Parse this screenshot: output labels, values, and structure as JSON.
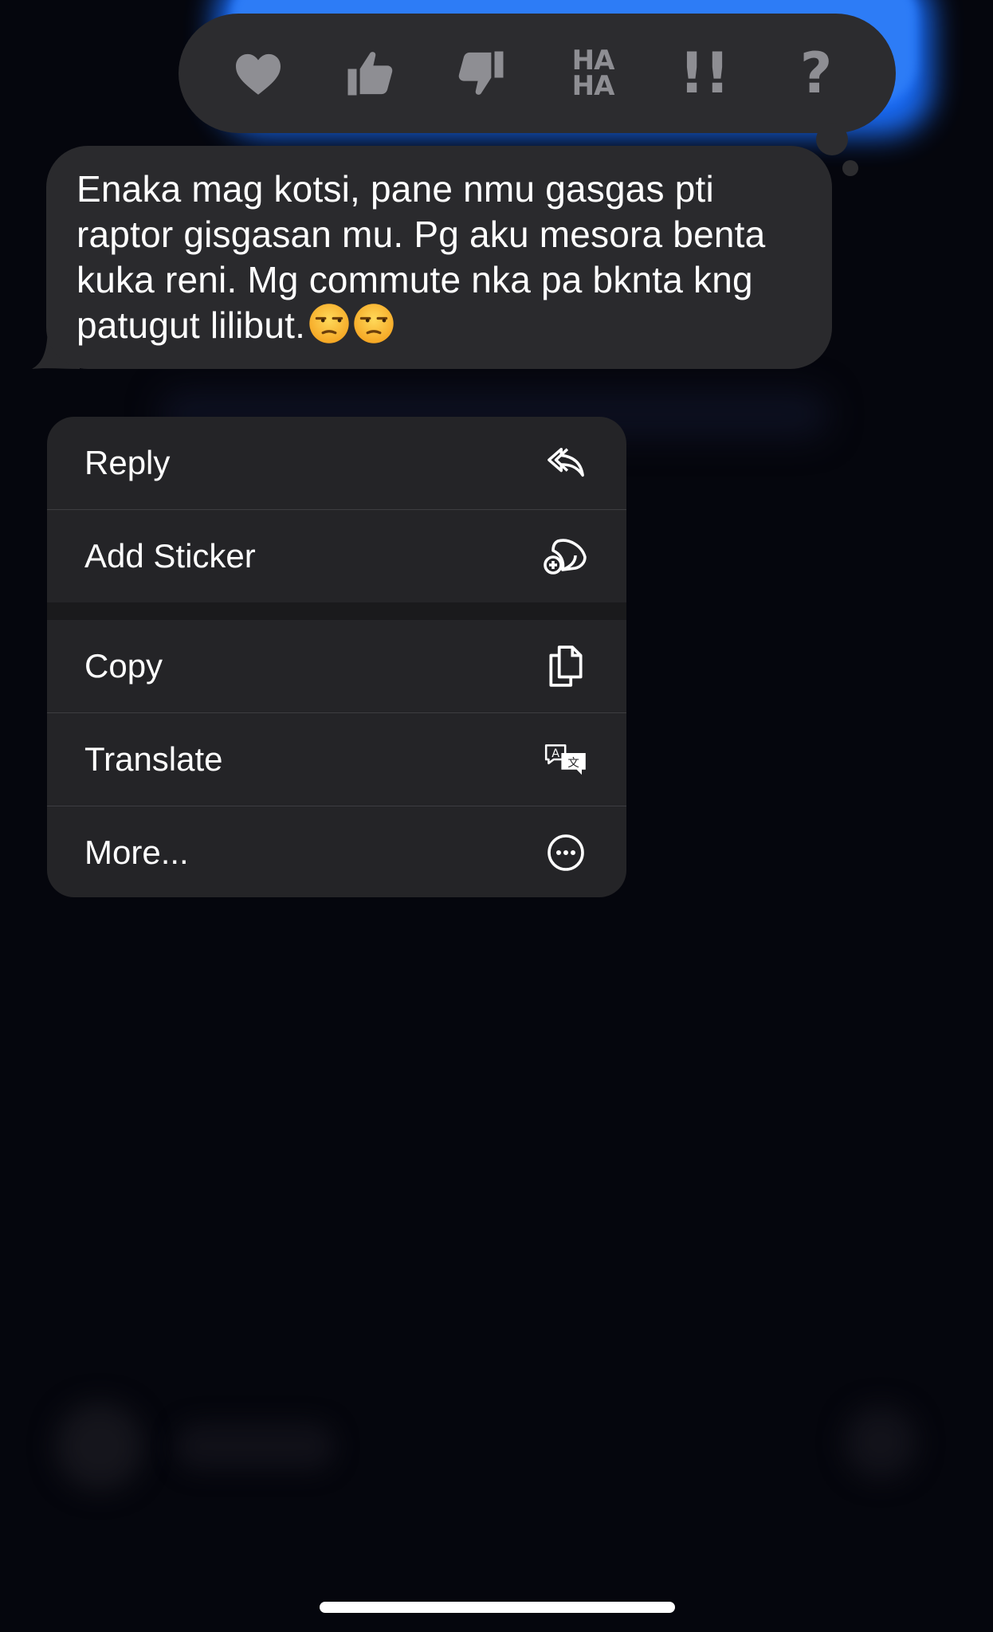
{
  "tapback": {
    "reactions": [
      {
        "name": "heart-icon"
      },
      {
        "name": "thumbs-up-icon"
      },
      {
        "name": "thumbs-down-icon"
      },
      {
        "name": "haha-icon",
        "line1": "HA",
        "line2": "HA"
      },
      {
        "name": "exclamation-icon",
        "text": "!!"
      },
      {
        "name": "question-icon",
        "text": "?"
      }
    ]
  },
  "message": {
    "text": "Enaka mag kotsi, pane nmu gasgas pti raptor gisgasan mu. Pg aku mesora benta kuka reni. Mg commute nka pa bknta kng patugut lilibut.",
    "emojis": [
      "unamused-face-emoji",
      "unamused-face-emoji"
    ]
  },
  "menu": {
    "items": [
      {
        "label": "Reply",
        "icon": "reply-icon"
      },
      {
        "label": "Add Sticker",
        "icon": "add-sticker-icon"
      },
      {
        "label": "Copy",
        "icon": "copy-icon"
      },
      {
        "label": "Translate",
        "icon": "translate-icon"
      },
      {
        "label": "More...",
        "icon": "more-icon"
      }
    ]
  },
  "colors": {
    "background": "#05060d",
    "bubble": "#2a2a2d",
    "menu": "#242427",
    "reaction_icon": "#8e8e93",
    "accent_blue": "#2d7cf6"
  }
}
